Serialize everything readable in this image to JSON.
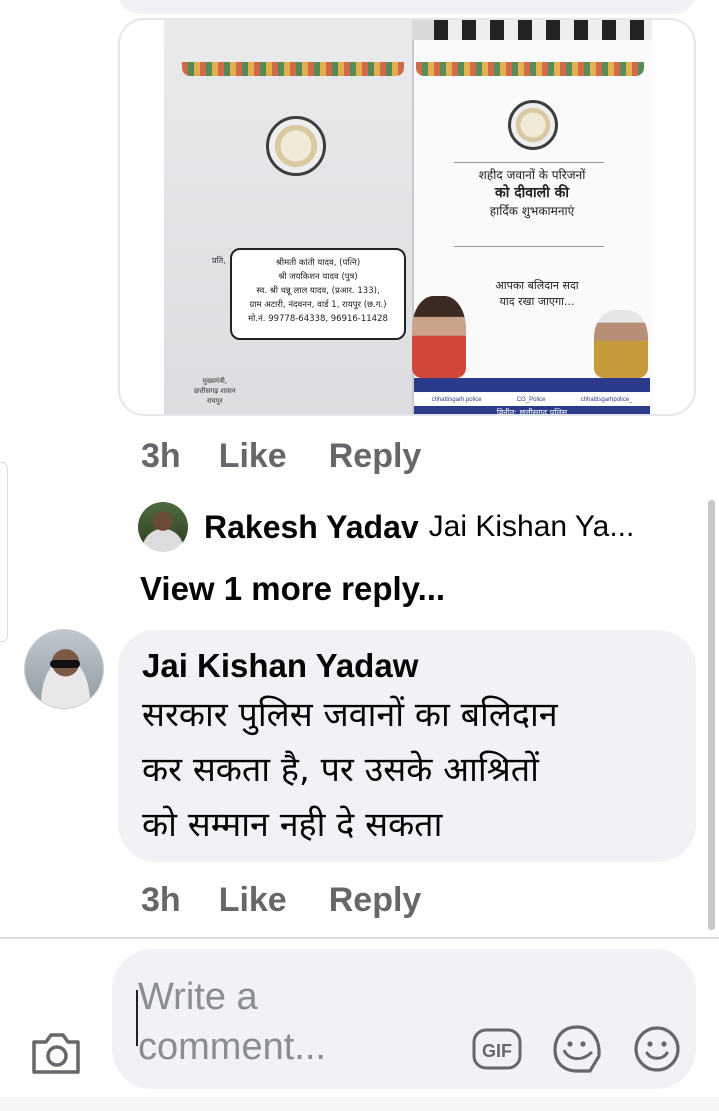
{
  "post_image": {
    "envelope": {
      "prati": "प्रति,",
      "address_lines": [
        "श्रीमती कांती यादव, (पत्नि)",
        "श्री जयकिशन यादव (पुत्र)",
        "स्व. श्री धन्नू लाल यादव, (प्रआर. 133),",
        "ग्राम अटारी, नंदवनन, वार्ड 1, रायपुर (छ.ग.)",
        "मो.नं. 99778-64338, 96916-11428"
      ],
      "sender_lines": [
        "मुख्यमंत्री,",
        "छत्तीसगढ़ शासन",
        "रायपुर"
      ]
    },
    "card": {
      "greeting_line1": "शहीद जवानों के परिजनों",
      "greeting_line2": "को दीवाली की",
      "greeting_line3": "हार्दिक शुभकामनाएं",
      "sacrifice_line1": "आपका बलिदान सदा",
      "sacrifice_line2": "याद रखा जाएगा...",
      "social": [
        "chhattisgarh.police",
        "CG_Police",
        "chhattisgarhpolice_"
      ],
      "vinit": "विनीत: छत्तीसगढ़ पुलिस"
    }
  },
  "first_actions": {
    "time": "3h",
    "like": "Like",
    "reply": "Reply"
  },
  "reply_preview": {
    "name": "Rakesh Yadav",
    "text": "Jai Kishan Ya..."
  },
  "view_more": "View 1 more reply...",
  "comment": {
    "author": "Jai Kishan Yadaw",
    "lines": [
      "सरकार पुलिस जवानों का बलिदान",
      "कर सकता है, पर उसके आश्रितों",
      "को सम्मान नही दे सकता"
    ]
  },
  "second_actions": {
    "time": "3h",
    "like": "Like",
    "reply": "Reply"
  },
  "composer": {
    "placeholder": "Write a comment...",
    "gif_label": "GIF"
  },
  "colors": {
    "meta_text": "#65676b",
    "bubble": "#f0f2f5",
    "text": "#050505"
  }
}
